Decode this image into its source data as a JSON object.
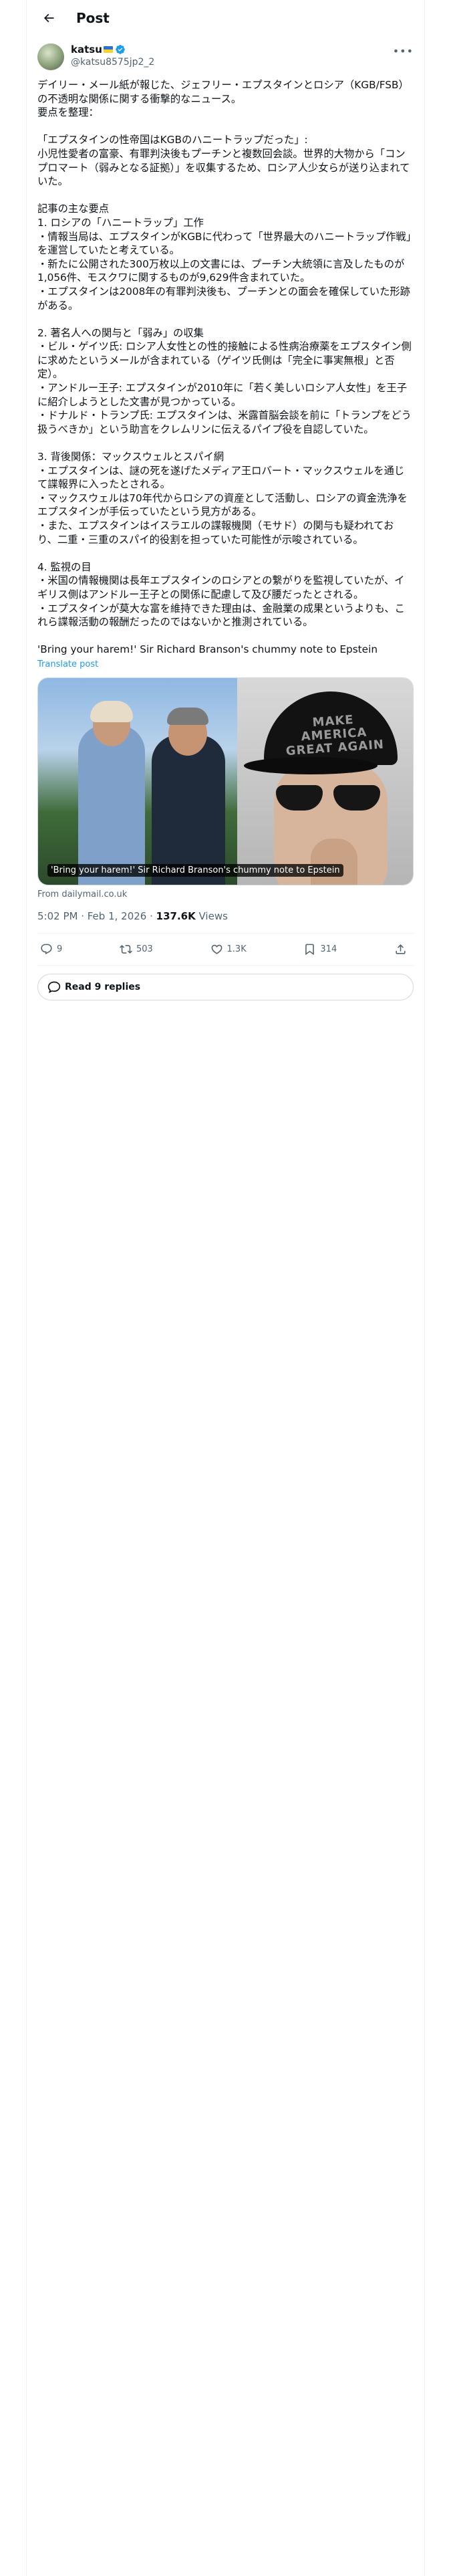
{
  "header": {
    "title": "Post"
  },
  "author": {
    "name": "katsu",
    "handle": "@katsu8575jp2_2"
  },
  "tweet": {
    "text": "デイリー・メール紙が報じた、ジェフリー・エプスタインとロシア（KGB/FSB）の不透明な関係に関する衝撃的なニュース。\n要点を整理：\n\n「エプスタインの性帝国はKGBのハニートラップだった」:\n小児性愛者の富豪、有罪判決後もプーチンと複数回会談。世界的大物から「コンプロマート（弱みとなる証拠）」を収集するため、ロシア人少女らが送り込まれていた。\n\n記事の主な要点\n1. ロシアの「ハニートラップ」工作\n・情報当局は、エプスタインがKGBに代わって「世界最大のハニートラップ作戦」を運営していたと考えている。\n・新たに公開された300万枚以上の文書には、プーチン大統領に言及したものが1,056件、モスクワに関するものが9,629件含まれていた。\n・エプスタインは2008年の有罪判決後も、プーチンとの面会を確保していた形跡がある。\n\n2. 著名人への関与と「弱み」の収集\n・ビル・ゲイツ氏: ロシア人女性との性的接触による性病治療薬をエプスタイン側に求めたというメールが含まれている（ゲイツ氏側は「完全に事実無根」と否定）。\n・アンドルー王子: エプスタインが2010年に「若く美しいロシア人女性」を王子に紹介しようとした文書が見つかっている。\n・ドナルド・トランプ氏: エプスタインは、米露首脳会談を前に「トランプをどう扱うべきか」という助言をクレムリンに伝えるパイプ役を自認していた。\n\n3. 背後関係：マックスウェルとスパイ網\n・エプスタインは、謎の死を遂げたメディア王ロバート・マックスウェルを通じて諜報界に入ったとされる。\n・マックスウェルは70年代からロシアの資産として活動し、ロシアの資金洗浄をエプスタインが手伝っていたという見方がある。\n・また、エプスタインはイスラエルの諜報機関（モサド）の関与も疑われており、二重・三重のスパイ的役割を担っていた可能性が示唆されている。\n\n4. 監視の目\n・米国の情報機関は長年エプスタインのロシアとの繋がりを監視していたが、イギリス側はアンドルー王子との関係に配慮して及び腰だったとされる。\n・エプスタインが莫大な富を維持できた理由は、金融業の成果というよりも、これら諜報活動の報酬だったのではないかと推測されている。\n\n'Bring your harem!' Sir Richard Branson's chummy note to Epstein",
    "translate_label": "Translate post"
  },
  "media_card": {
    "cap_text": "MAKE AMERICA GREAT AGAIN",
    "caption": "'Bring your harem!' Sir Richard Branson's chummy note to Epstein",
    "source": "From dailymail.co.uk"
  },
  "meta": {
    "time": "5:02 PM · Feb 1, 2026 · ",
    "views_count": "137.6K",
    "views_label": " Views"
  },
  "actions": {
    "replies": "9",
    "reposts": "503",
    "likes": "1.3K",
    "bookmarks": "314"
  },
  "read_replies": {
    "label": "Read 9 replies"
  },
  "colors": {
    "link": "#1d9bf0",
    "muted": "#536471",
    "text": "#0f1419",
    "border": "#eff3f4"
  }
}
